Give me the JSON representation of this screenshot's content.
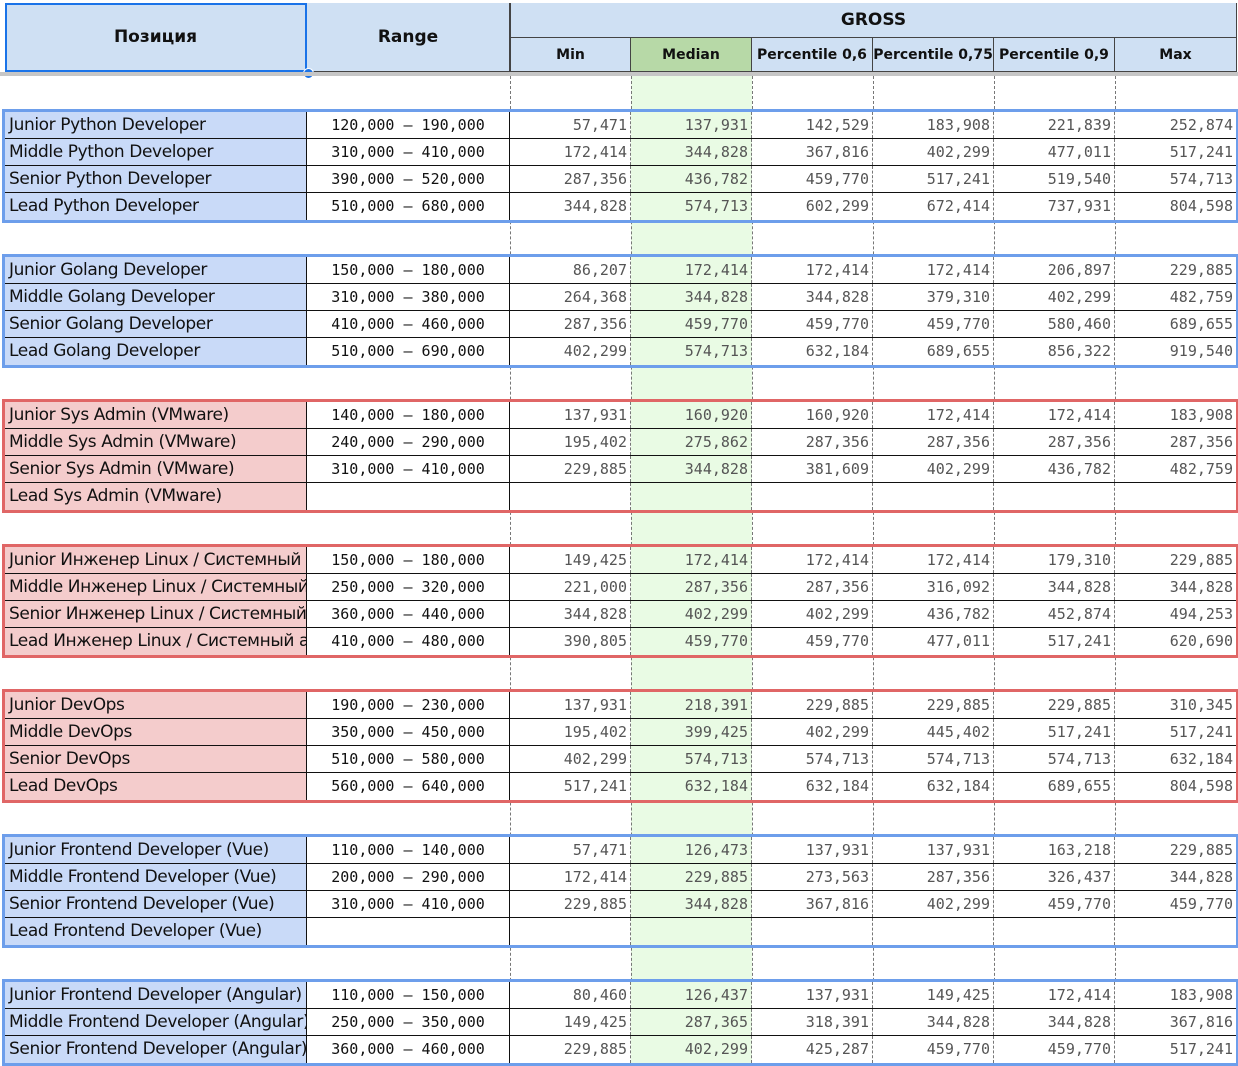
{
  "header": {
    "position": "Позиция",
    "range": "Range",
    "gross": "GROSS",
    "columns": [
      "Min",
      "Median",
      "Percentile 0,6",
      "Percentile 0,75",
      "Percentile 0,9",
      "Max"
    ]
  },
  "colors": {
    "blue_group": "#6d9eeb",
    "red_group": "#e06666",
    "median_highlight": "#b7d9a7"
  },
  "groups": [
    {
      "color": "blue",
      "rows": [
        {
          "name": "Junior Python Developer",
          "range": "120,000 – 190,000",
          "values": [
            "57,471",
            "137,931",
            "142,529",
            "183,908",
            "221,839",
            "252,874"
          ]
        },
        {
          "name": "Middle Python Developer",
          "range": "310,000 – 410,000",
          "values": [
            "172,414",
            "344,828",
            "367,816",
            "402,299",
            "477,011",
            "517,241"
          ]
        },
        {
          "name": "Senior Python Developer",
          "range": "390,000 – 520,000",
          "values": [
            "287,356",
            "436,782",
            "459,770",
            "517,241",
            "519,540",
            "574,713"
          ]
        },
        {
          "name": "Lead Python Developer",
          "range": "510,000 – 680,000",
          "values": [
            "344,828",
            "574,713",
            "602,299",
            "672,414",
            "737,931",
            "804,598"
          ]
        }
      ]
    },
    {
      "color": "blue",
      "rows": [
        {
          "name": "Junior Golang Developer",
          "range": "150,000 – 180,000",
          "values": [
            "86,207",
            "172,414",
            "172,414",
            "172,414",
            "206,897",
            "229,885"
          ]
        },
        {
          "name": "Middle Golang Developer",
          "range": "310,000 – 380,000",
          "values": [
            "264,368",
            "344,828",
            "344,828",
            "379,310",
            "402,299",
            "482,759"
          ]
        },
        {
          "name": "Senior Golang Developer",
          "range": "410,000 – 460,000",
          "values": [
            "287,356",
            "459,770",
            "459,770",
            "459,770",
            "580,460",
            "689,655"
          ]
        },
        {
          "name": "Lead Golang Developer",
          "range": "510,000 – 690,000",
          "values": [
            "402,299",
            "574,713",
            "632,184",
            "689,655",
            "856,322",
            "919,540"
          ]
        }
      ]
    },
    {
      "color": "red",
      "rows": [
        {
          "name": "Junior Sys Admin (VMware)",
          "range": "140,000 – 180,000",
          "values": [
            "137,931",
            "160,920",
            "160,920",
            "172,414",
            "172,414",
            "183,908"
          ]
        },
        {
          "name": "Middle Sys Admin (VMware)",
          "range": "240,000 – 290,000",
          "values": [
            "195,402",
            "275,862",
            "287,356",
            "287,356",
            "287,356",
            "287,356"
          ]
        },
        {
          "name": "Senior Sys Admin (VMware)",
          "range": "310,000 – 410,000",
          "values": [
            "229,885",
            "344,828",
            "381,609",
            "402,299",
            "436,782",
            "482,759"
          ]
        },
        {
          "name": "Lead Sys Admin (VMware)",
          "range": "",
          "values": [
            "",
            "",
            "",
            "",
            "",
            ""
          ]
        }
      ]
    },
    {
      "color": "red",
      "rows": [
        {
          "name": "Junior Инженер Linux / Системный а",
          "range": "150,000 – 180,000",
          "values": [
            "149,425",
            "172,414",
            "172,414",
            "172,414",
            "179,310",
            "229,885"
          ]
        },
        {
          "name": "Middle Инженер Linux / Системный а",
          "range": "250,000 – 320,000",
          "values": [
            "221,000",
            "287,356",
            "287,356",
            "316,092",
            "344,828",
            "344,828"
          ]
        },
        {
          "name": "Senior Инженер Linux / Системный а",
          "range": "360,000 – 440,000",
          "values": [
            "344,828",
            "402,299",
            "402,299",
            "436,782",
            "452,874",
            "494,253"
          ]
        },
        {
          "name": "Lead Инженер Linux / Системный ад",
          "range": "410,000 – 480,000",
          "values": [
            "390,805",
            "459,770",
            "459,770",
            "477,011",
            "517,241",
            "620,690"
          ]
        }
      ]
    },
    {
      "color": "red",
      "rows": [
        {
          "name": "Junior DevOps",
          "range": "190,000 – 230,000",
          "values": [
            "137,931",
            "218,391",
            "229,885",
            "229,885",
            "229,885",
            "310,345"
          ]
        },
        {
          "name": "Middle DevOps",
          "range": "350,000 – 450,000",
          "values": [
            "195,402",
            "399,425",
            "402,299",
            "445,402",
            "517,241",
            "517,241"
          ]
        },
        {
          "name": "Senior DevOps",
          "range": "510,000 – 580,000",
          "values": [
            "402,299",
            "574,713",
            "574,713",
            "574,713",
            "574,713",
            "632,184"
          ]
        },
        {
          "name": "Lead DevOps",
          "range": "560,000 – 640,000",
          "values": [
            "517,241",
            "632,184",
            "632,184",
            "632,184",
            "689,655",
            "804,598"
          ]
        }
      ]
    },
    {
      "color": "blue",
      "rows": [
        {
          "name": "Junior Frontend Developer (Vue)",
          "range": "110,000 – 140,000",
          "values": [
            "57,471",
            "126,473",
            "137,931",
            "137,931",
            "163,218",
            "229,885"
          ]
        },
        {
          "name": "Middle Frontend Developer (Vue)",
          "range": "200,000 – 290,000",
          "values": [
            "172,414",
            "229,885",
            "273,563",
            "287,356",
            "326,437",
            "344,828"
          ]
        },
        {
          "name": "Senior Frontend Developer (Vue)",
          "range": "310,000 – 410,000",
          "values": [
            "229,885",
            "344,828",
            "367,816",
            "402,299",
            "459,770",
            "459,770"
          ]
        },
        {
          "name": "Lead Frontend Developer (Vue)",
          "range": "",
          "values": [
            "",
            "",
            "",
            "",
            "",
            ""
          ]
        }
      ]
    },
    {
      "color": "blue",
      "rows": [
        {
          "name": "Junior Frontend Developer (Angular)",
          "range": "110,000 – 150,000",
          "values": [
            "80,460",
            "126,437",
            "137,931",
            "149,425",
            "172,414",
            "183,908"
          ]
        },
        {
          "name": "Middle Frontend Developer (Angular)",
          "range": "250,000 – 350,000",
          "values": [
            "149,425",
            "287,365",
            "318,391",
            "344,828",
            "344,828",
            "367,816"
          ]
        },
        {
          "name": "Senior Frontend Developer (Angular)",
          "range": "360,000 – 460,000",
          "values": [
            "229,885",
            "402,299",
            "425,287",
            "459,770",
            "459,770",
            "517,241"
          ]
        }
      ]
    }
  ]
}
